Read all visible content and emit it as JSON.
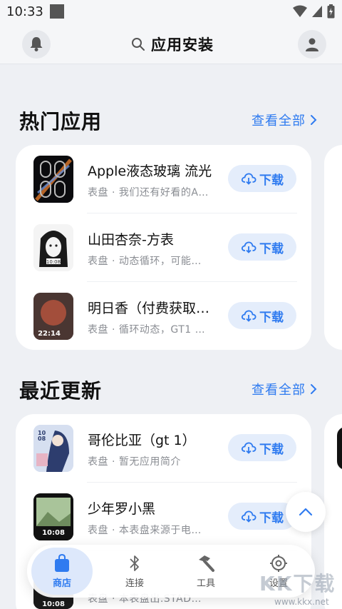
{
  "status": {
    "time": "10:33"
  },
  "header": {
    "title": "应用安装"
  },
  "sections": [
    {
      "title": "热门应用",
      "see_all": "查看全部",
      "apps": [
        {
          "name": "Apple液态玻璃 流光",
          "desc": "表盘 · 我们还有好看的A…",
          "button": "下载"
        },
        {
          "name": "山田杏奈-方表",
          "desc": "表盘 · 动态循环，可能…",
          "button": "下载"
        },
        {
          "name": "明日香（付费获取…",
          "desc": "表盘 · 循环动态，GT1 …",
          "button": "下载"
        }
      ]
    },
    {
      "title": "最近更新",
      "see_all": "查看全部",
      "apps": [
        {
          "name": "哥伦比亚（gt 1）",
          "desc": "表盘 · 暂无应用简介",
          "button": "下载"
        },
        {
          "name": "少年罗小黑",
          "desc": "表盘 · 本表盘来源于电…",
          "button": "下载"
        },
        {
          "name": "",
          "desc": "表盘 · 本表盘出.STAD…",
          "button": ""
        }
      ]
    }
  ],
  "icon_texts": {
    "clock_a": "10:08",
    "clock_b": "22:14",
    "clock_c": "10:08"
  },
  "nav": [
    {
      "label": "商店",
      "icon": "bag-icon",
      "active": true
    },
    {
      "label": "连接",
      "icon": "bluetooth-icon",
      "active": false
    },
    {
      "label": "工具",
      "icon": "hammer-icon",
      "active": false
    },
    {
      "label": "设置",
      "icon": "gear-icon",
      "active": false
    }
  ],
  "watermark": {
    "text": "KK下载",
    "url": "www.kkx.net"
  },
  "colors": {
    "accent": "#2f7bf0",
    "button_bg": "#e4edfb",
    "page_bg": "#eef0f4"
  }
}
